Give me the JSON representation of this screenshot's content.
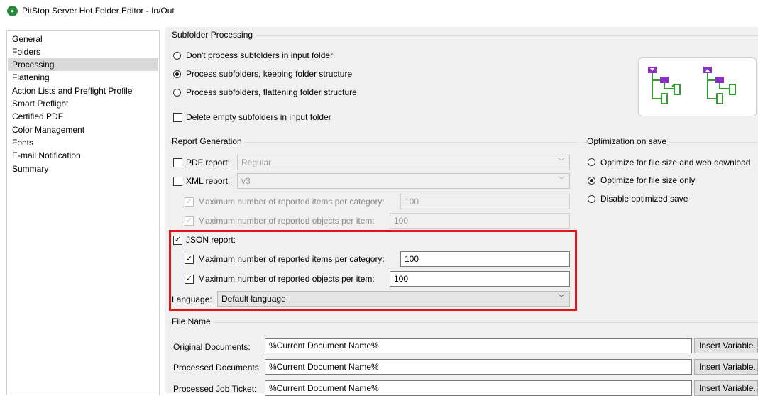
{
  "window": {
    "title": "PitStop Server Hot Folder Editor - In/Out",
    "icon": "pitstop-app-icon"
  },
  "sidebar": {
    "items": [
      {
        "label": "General",
        "selected": false
      },
      {
        "label": "Folders",
        "selected": false
      },
      {
        "label": "Processing",
        "selected": true
      },
      {
        "label": "Flattening",
        "selected": false
      },
      {
        "label": "Action Lists and Preflight Profile",
        "selected": false
      },
      {
        "label": "Smart Preflight",
        "selected": false
      },
      {
        "label": "Certified PDF",
        "selected": false
      },
      {
        "label": "Color Management",
        "selected": false
      },
      {
        "label": "Fonts",
        "selected": false
      },
      {
        "label": "E-mail Notification",
        "selected": false
      },
      {
        "label": "Summary",
        "selected": false
      }
    ]
  },
  "subfolder": {
    "title": "Subfolder Processing",
    "options": [
      {
        "label": "Don't process subfolders in input folder",
        "selected": false
      },
      {
        "label": "Process subfolders, keeping folder structure",
        "selected": true
      },
      {
        "label": "Process subfolders, flattening folder structure",
        "selected": false
      }
    ],
    "delete_empty": {
      "label": "Delete empty subfolders in input folder",
      "checked": false
    }
  },
  "report": {
    "title": "Report Generation",
    "pdf": {
      "label": "PDF report:",
      "checked": false,
      "value": "Regular"
    },
    "xml": {
      "label": "XML report:",
      "checked": false,
      "value": "v3"
    },
    "xml_items": {
      "label": "Maximum number of reported items per category:",
      "checked": true,
      "value": "100"
    },
    "xml_objects": {
      "label": "Maximum number of reported objects per item:",
      "checked": true,
      "value": "100"
    },
    "json": {
      "label": "JSON report:",
      "checked": true
    },
    "json_items": {
      "label": "Maximum number of reported items per category:",
      "checked": true,
      "value": "100"
    },
    "json_objects": {
      "label": "Maximum number of reported objects per item:",
      "checked": true,
      "value": "100"
    },
    "language": {
      "label": "Language:",
      "value": "Default language"
    }
  },
  "optimization": {
    "title": "Optimization on save",
    "options": [
      {
        "label": "Optimize for file size and web download",
        "selected": false
      },
      {
        "label": "Optimize for file size only",
        "selected": true
      },
      {
        "label": "Disable optimized save",
        "selected": false
      }
    ]
  },
  "filename": {
    "title": "File Name",
    "rows": [
      {
        "label": "Original Documents:",
        "value": "%Current Document Name%",
        "button": "Insert Variable..."
      },
      {
        "label": "Processed Documents:",
        "value": "%Current Document Name%",
        "button": "Insert Variable..."
      },
      {
        "label": "Processed Job Ticket:",
        "value": "%Current Document Name%",
        "button": "Insert Variable..."
      }
    ]
  },
  "colors": {
    "highlight": "#e4141b",
    "folder": "#8b2fc9",
    "file": "#2e9e2e"
  }
}
